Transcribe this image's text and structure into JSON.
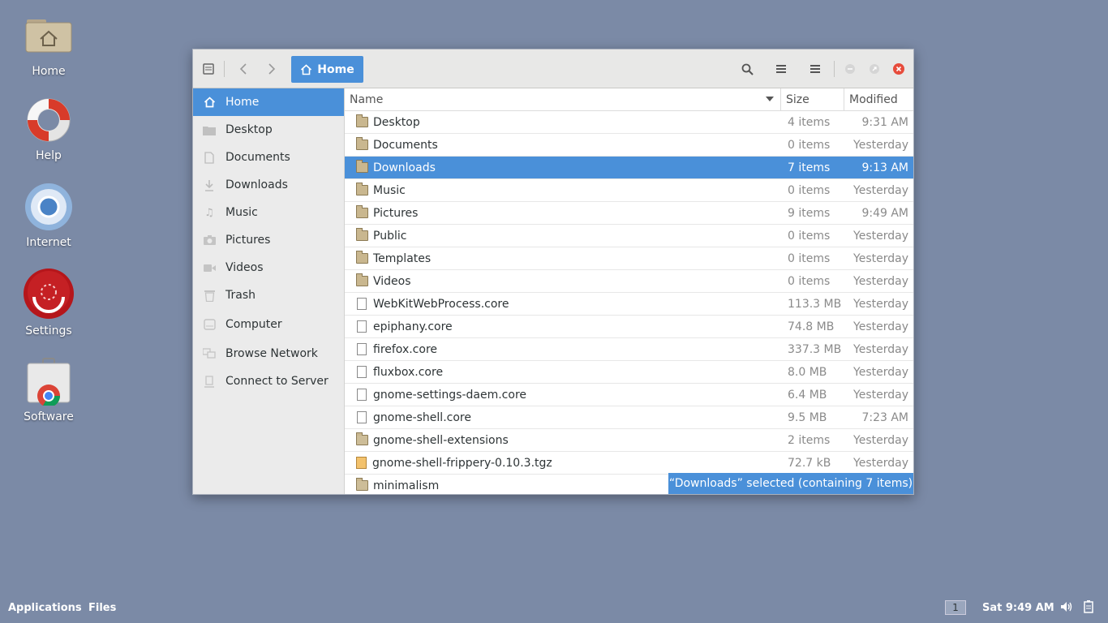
{
  "desktop": {
    "icons": [
      {
        "label": "Home"
      },
      {
        "label": "Help"
      },
      {
        "label": "Internet"
      },
      {
        "label": "Settings"
      },
      {
        "label": "Software"
      }
    ]
  },
  "window": {
    "path_label": "Home",
    "sidebar": [
      {
        "label": "Home",
        "icon": "home-icon",
        "active": true
      },
      {
        "label": "Desktop",
        "icon": "folder-icon"
      },
      {
        "label": "Documents",
        "icon": "document-icon"
      },
      {
        "label": "Downloads",
        "icon": "download-icon"
      },
      {
        "label": "Music",
        "icon": "music-icon"
      },
      {
        "label": "Pictures",
        "icon": "camera-icon"
      },
      {
        "label": "Videos",
        "icon": "video-icon"
      },
      {
        "label": "Trash",
        "icon": "trash-icon"
      },
      {
        "label": "Computer",
        "icon": "computer-icon"
      },
      {
        "label": "Browse Network",
        "icon": "network-icon"
      },
      {
        "label": "Connect to Server",
        "icon": "server-icon"
      }
    ],
    "columns": {
      "name": "Name",
      "size": "Size",
      "modified": "Modified"
    },
    "files": [
      {
        "name": "Desktop",
        "size": "4 items",
        "modified": "9:31 AM",
        "type": "folder"
      },
      {
        "name": "Documents",
        "size": "0 items",
        "modified": "Yesterday",
        "type": "folder"
      },
      {
        "name": "Downloads",
        "size": "7 items",
        "modified": "9:13 AM",
        "type": "folder",
        "selected": true
      },
      {
        "name": "Music",
        "size": "0 items",
        "modified": "Yesterday",
        "type": "folder"
      },
      {
        "name": "Pictures",
        "size": "9 items",
        "modified": "9:49 AM",
        "type": "folder"
      },
      {
        "name": "Public",
        "size": "0 items",
        "modified": "Yesterday",
        "type": "folder"
      },
      {
        "name": "Templates",
        "size": "0 items",
        "modified": "Yesterday",
        "type": "folder"
      },
      {
        "name": "Videos",
        "size": "0 items",
        "modified": "Yesterday",
        "type": "folder"
      },
      {
        "name": "WebKitWebProcess.core",
        "size": "113.3 MB",
        "modified": "Yesterday",
        "type": "file"
      },
      {
        "name": "epiphany.core",
        "size": "74.8 MB",
        "modified": "Yesterday",
        "type": "file"
      },
      {
        "name": "firefox.core",
        "size": "337.3 MB",
        "modified": "Yesterday",
        "type": "file"
      },
      {
        "name": "fluxbox.core",
        "size": "8.0 MB",
        "modified": "Yesterday",
        "type": "file"
      },
      {
        "name": "gnome-settings-daem.core",
        "size": "6.4 MB",
        "modified": "Yesterday",
        "type": "file"
      },
      {
        "name": "gnome-shell.core",
        "size": "9.5 MB",
        "modified": "7:23 AM",
        "type": "file"
      },
      {
        "name": "gnome-shell-extensions",
        "size": "2 items",
        "modified": "Yesterday",
        "type": "folder-plain"
      },
      {
        "name": "gnome-shell-frippery-0.10.3.tgz",
        "size": "72.7 kB",
        "modified": "Yesterday",
        "type": "archive"
      },
      {
        "name": "minimalism",
        "size": "",
        "modified": "",
        "type": "folder-plain"
      }
    ],
    "status": "“Downloads” selected  (containing 7 items)"
  },
  "taskbar": {
    "applications": "Applications",
    "files": "Files",
    "workspace": "1",
    "clock": "Sat  9:49 AM"
  },
  "colors": {
    "accent": "#4a90d9",
    "desktop": "#7b8aa6",
    "close": "#e74c3c"
  }
}
